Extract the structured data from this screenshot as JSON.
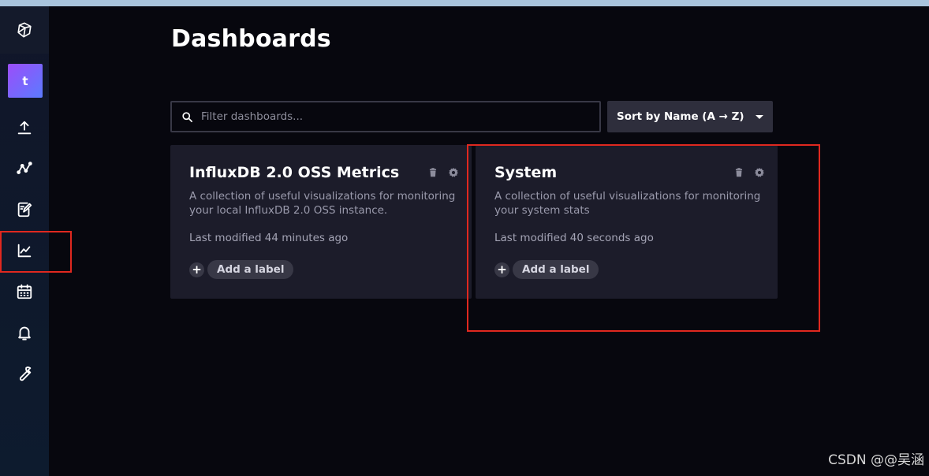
{
  "sidebar": {
    "org_initial": "t",
    "items": [
      {
        "icon": "upload-icon",
        "name": "Load Data"
      },
      {
        "icon": "data-explorer-icon",
        "name": "Data Explorer"
      },
      {
        "icon": "notebook-icon",
        "name": "Notebooks"
      },
      {
        "icon": "dashboards-icon",
        "name": "Dashboards",
        "selected": true
      },
      {
        "icon": "calendar-icon",
        "name": "Tasks"
      },
      {
        "icon": "bell-icon",
        "name": "Alerts"
      },
      {
        "icon": "wrench-icon",
        "name": "Settings"
      }
    ]
  },
  "page": {
    "title": "Dashboards",
    "search_placeholder": "Filter dashboards...",
    "sort_label": "Sort by Name (A → Z)"
  },
  "cards": [
    {
      "title": "InfluxDB 2.0 OSS Metrics",
      "description": "A collection of useful visualizations for monitoring your local InfluxDB 2.0 OSS instance.",
      "modified": "Last modified 44 minutes ago",
      "add_label": "Add a label"
    },
    {
      "title": "System",
      "description": "A collection of useful visualizations for monitoring your system stats",
      "modified": "Last modified 40 seconds ago",
      "add_label": "Add a label"
    }
  ],
  "watermark": "CSDN @@吴涵",
  "colors": {
    "background": "#07070e",
    "card": "#1c1c2a",
    "annotation": "#e0281f",
    "avatar_gradient": [
      "#9b4dfa",
      "#5b7bff"
    ]
  }
}
